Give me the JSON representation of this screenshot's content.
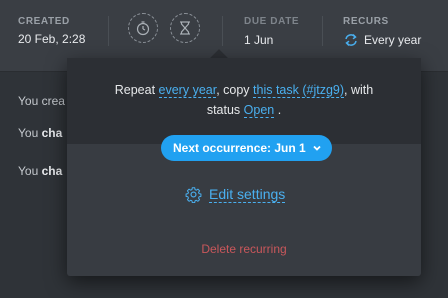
{
  "header": {
    "created_label": "CREATED",
    "created_value": "20 Feb, 2:28",
    "due_label": "DUE DATE",
    "due_value": "1 Jun",
    "recurs_label": "RECURS",
    "recurs_value": "Every year"
  },
  "feed": {
    "rows": [
      {
        "prefix": "You",
        "text": "crea"
      },
      {
        "prefix": "You",
        "text": "cha"
      },
      {
        "prefix": "You",
        "text": "cha"
      }
    ]
  },
  "popover": {
    "sentence_1": "Repeat ",
    "every_year_link": "every year",
    "sentence_2": ", copy ",
    "this_task_link": "this task (#jtzg9)",
    "sentence_3": ", with",
    "sentence_4": "status ",
    "status_link": "Open",
    "sentence_5": " .",
    "next_occurrence": "Next occurrence: Jun 1",
    "edit_settings": "Edit settings",
    "delete_recurring": "Delete recurring"
  },
  "colors": {
    "accent": "#21a1f1",
    "link": "#4ab0f0",
    "danger": "#c9575b"
  }
}
